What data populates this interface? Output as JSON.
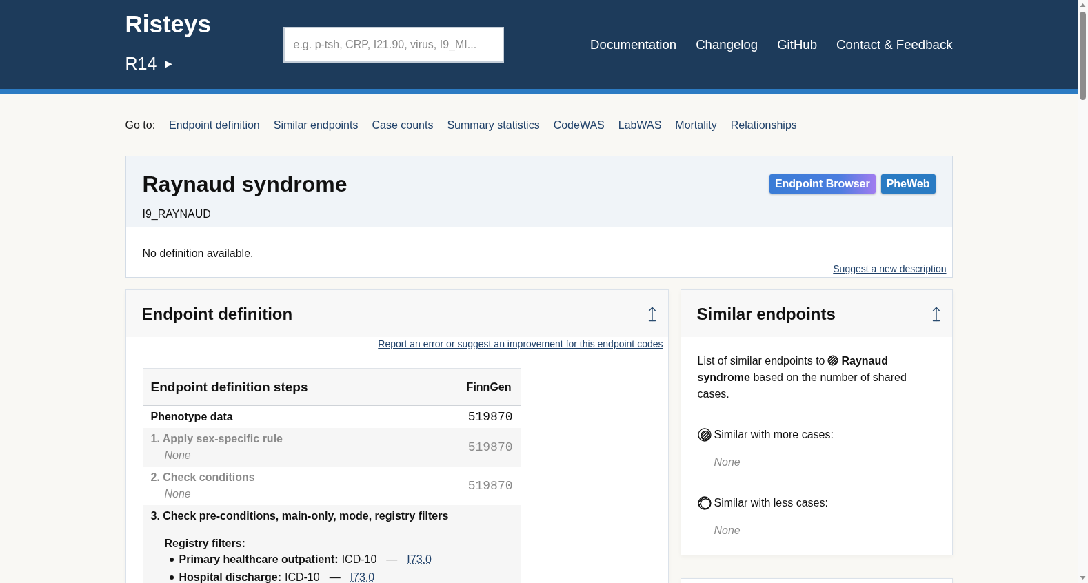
{
  "header": {
    "brand": "Risteys",
    "release": {
      "label": "R14",
      "toggle": "▶"
    },
    "search": {
      "placeholder": "e.g. p-tsh, CRP, I21.90, virus, I9_MI..."
    },
    "nav": [
      "Documentation",
      "Changelog",
      "GitHub",
      "Contact & Feedback"
    ]
  },
  "goto": {
    "label": "Go to:",
    "links": [
      "Endpoint definition",
      "Similar endpoints",
      "Case counts",
      "Summary statistics",
      "CodeWAS",
      "LabWAS",
      "Mortality",
      "Relationships"
    ]
  },
  "endpoint": {
    "title": "Raynaud syndrome",
    "code": "I9_RAYNAUD",
    "buttons": [
      {
        "label": "Endpoint Browser",
        "kind": "gradient"
      },
      {
        "label": "PheWeb",
        "kind": "solid"
      }
    ],
    "description": "No definition available.",
    "suggest_link": "Suggest a new description"
  },
  "endpoint_definition": {
    "title": "Endpoint definition",
    "report_link": "Report an error or suggest an improvement for this endpoint codes",
    "table": {
      "columns": [
        "Endpoint definition steps",
        "FinnGen"
      ],
      "rows": [
        {
          "kind": "data",
          "label": "Phenotype data",
          "count": "519870",
          "greyed": false
        },
        {
          "kind": "step",
          "label": "1. Apply sex-specific rule",
          "detail": "None",
          "count": "519870",
          "greyed": true
        },
        {
          "kind": "step",
          "label": "2. Check conditions",
          "detail": "None",
          "count": "519870",
          "greyed": true
        },
        {
          "kind": "filters",
          "label": "3. Check pre-conditions, main-only, mode, registry filters",
          "greyed": false,
          "filters_title": "Registry filters:",
          "filters": [
            {
              "registry": "Primary healthcare outpatient:",
              "system": "ICD-10",
              "separator": "—",
              "code": "I73.0"
            },
            {
              "registry": "Hospital discharge:",
              "system": "ICD-10",
              "separator": "—",
              "code": "I73.0"
            }
          ]
        }
      ]
    }
  },
  "similar_endpoints": {
    "title": "Similar endpoints",
    "intro_before": "List of similar endpoints to",
    "intro_after": "**Raynaud syndrome** based on the number of shared cases.",
    "groups": [
      {
        "kind": "more",
        "label": "Similar with more cases:",
        "empty_text": "None"
      },
      {
        "kind": "less",
        "label": "Similar with less cases:",
        "empty_text": "None"
      }
    ]
  }
}
